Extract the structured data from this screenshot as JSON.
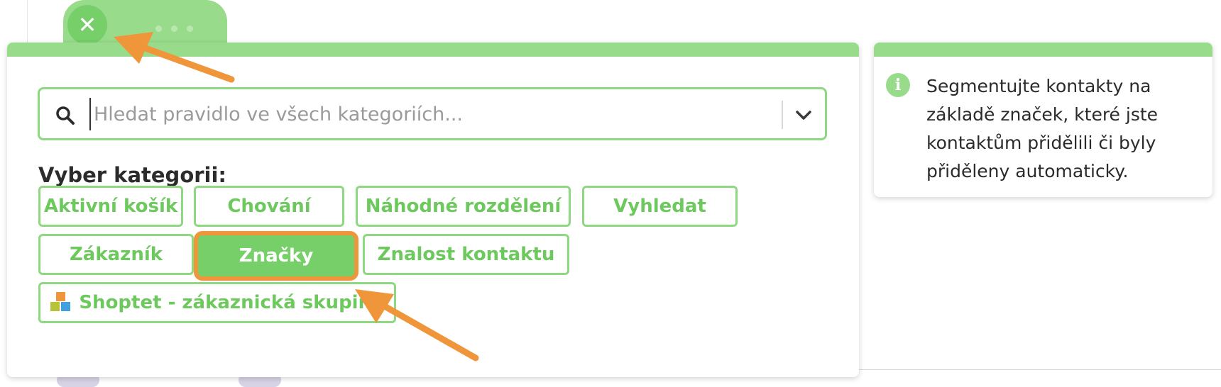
{
  "search": {
    "placeholder": "Hledat pravidlo ve všech kategoriích..."
  },
  "categories": {
    "title": "Vyber kategorii:",
    "items": [
      {
        "label": "Aktivní košík",
        "selected": false
      },
      {
        "label": "Chování",
        "selected": false
      },
      {
        "label": "Náhodné rozdělení",
        "selected": false
      },
      {
        "label": "Vyhledat",
        "selected": false
      },
      {
        "label": "Zákazník",
        "selected": false
      },
      {
        "label": "Značky",
        "selected": true
      },
      {
        "label": "Znalost kontaktu",
        "selected": false
      },
      {
        "label": "Shoptet - zákaznická skupina",
        "selected": false,
        "icon": "shoptet-icon"
      }
    ]
  },
  "info": {
    "text": "Segmentujte kontakty na základě značek, které jste kontaktům přidělili či byly přiděleny automaticky."
  },
  "tab": {
    "close_icon": "close-icon"
  },
  "colors": {
    "accent_green": "#76cf68",
    "light_green": "#98dc8b",
    "chip_text": "#6dc95d",
    "annotation_orange": "#f0963a"
  }
}
